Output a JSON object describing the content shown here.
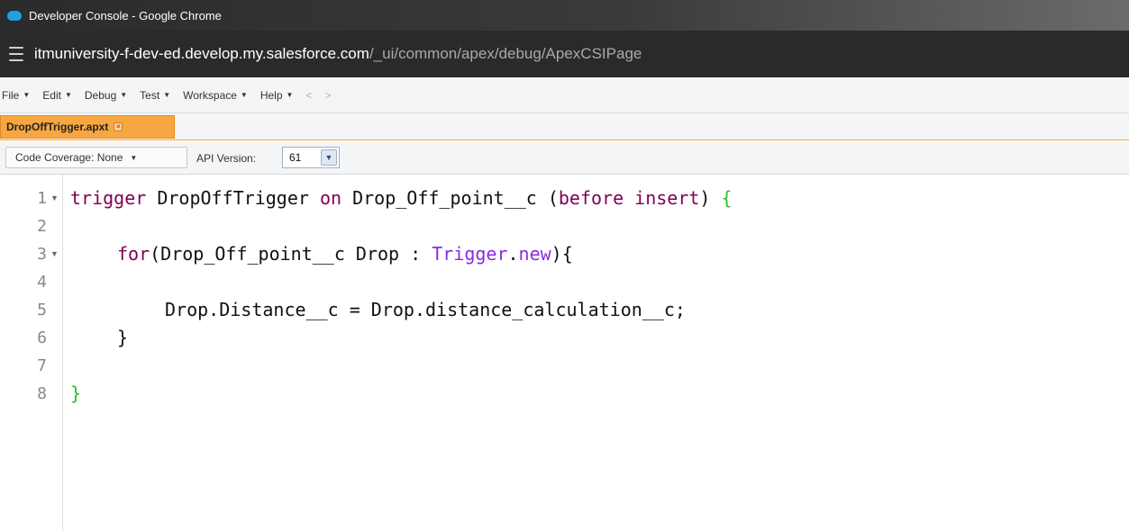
{
  "window": {
    "title": "Developer Console - Google Chrome",
    "url_host": "itmuniversity-f-dev-ed.develop.my.salesforce.com",
    "url_path": "/_ui/common/apex/debug/ApexCSIPage"
  },
  "menu": {
    "items": [
      "File",
      "Edit",
      "Debug",
      "Test",
      "Workspace",
      "Help"
    ],
    "back": "<",
    "forward": ">"
  },
  "tabs": [
    {
      "label": "DropOffTrigger.apxt",
      "active": true
    }
  ],
  "toolbar": {
    "code_coverage": "Code Coverage: None",
    "api_version_label": "API Version:",
    "api_version_value": "61"
  },
  "editor": {
    "line_numbers": [
      "1",
      "2",
      "3",
      "4",
      "5",
      "6",
      "7",
      "8"
    ],
    "lines": {
      "l1_kw1": "trigger",
      "l1_t1": " DropOffTrigger ",
      "l1_kw2": "on",
      "l1_t2": " Drop_Off_point__c (",
      "l1_kw3": "before",
      "l1_t3": " ",
      "l1_kw4": "insert",
      "l1_t4": ") ",
      "l1_brace": "{",
      "l3_kw1": "for",
      "l3_t1": "(Drop_Off_point__c Drop : ",
      "l3_kw2": "Trigger",
      "l3_t2": ".",
      "l3_kw3": "new",
      "l3_t3": "){",
      "l5": "Drop.Distance__c = Drop.distance_calculation__c;",
      "l6": "}",
      "l8": "}"
    }
  },
  "colors": {
    "tab_active": "#f7a742",
    "keyword": "#7f0055",
    "keyword_alt": "#8a2be2",
    "brace_highlight": "#29c229"
  }
}
